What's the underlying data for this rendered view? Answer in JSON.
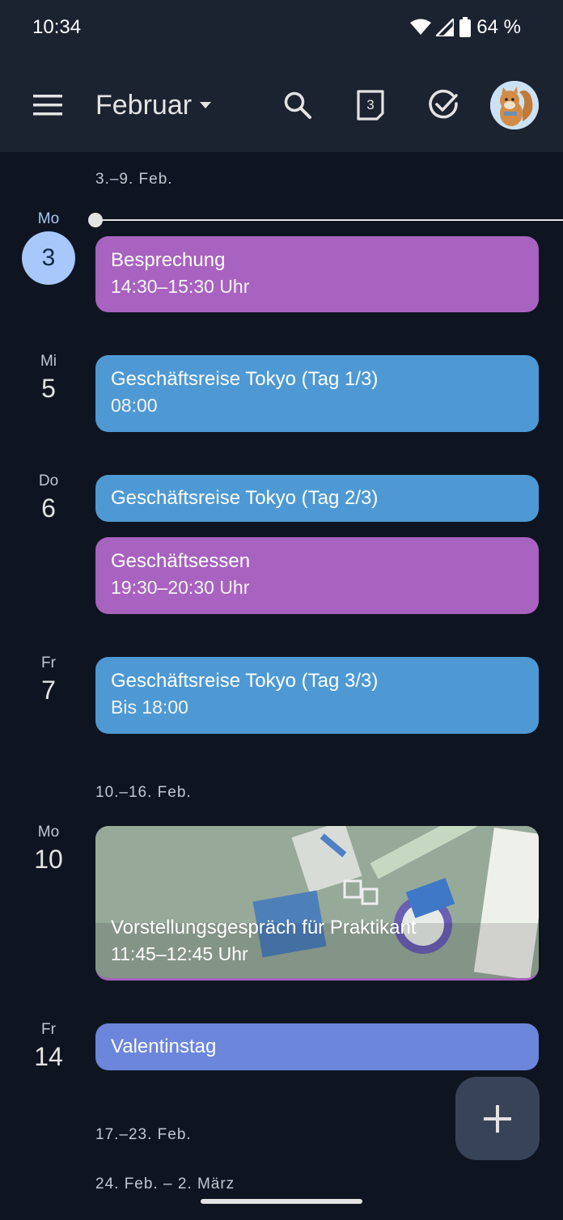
{
  "status_bar": {
    "time": "10:34",
    "battery": "64 %"
  },
  "app_bar": {
    "month": "Februar",
    "today_day": "3"
  },
  "weeks": [
    {
      "label": "3.–9. Feb."
    },
    {
      "label": "10.–16. Feb."
    },
    {
      "label": "17.–23. Feb."
    },
    {
      "label": "24. Feb. – 2. März"
    }
  ],
  "days": [
    {
      "name": "Mo",
      "num": "3"
    },
    {
      "name": "Mi",
      "num": "5"
    },
    {
      "name": "Do",
      "num": "6"
    },
    {
      "name": "Fr",
      "num": "7"
    },
    {
      "name": "Mo",
      "num": "10"
    },
    {
      "name": "Fr",
      "num": "14"
    }
  ],
  "events": [
    {
      "title": "Besprechung",
      "time": "14:30–15:30 Uhr",
      "color": "#a862bf"
    },
    {
      "title": "Geschäftsreise Tokyo (Tag 1/3)",
      "time": "08:00",
      "color": "#4e99d3"
    },
    {
      "title": "Geschäftsreise Tokyo (Tag 2/3)",
      "color": "#4e99d3"
    },
    {
      "title": "Geschäftsessen",
      "time": "19:30–20:30 Uhr",
      "color": "#a862bf"
    },
    {
      "title": "Geschäftsreise Tokyo (Tag 3/3)",
      "time": "Bis 18:00",
      "color": "#4e99d3"
    },
    {
      "title": "Vorstellungsgespräch für Praktikant",
      "time": "11:45–12:45 Uhr",
      "color": "#a862bf"
    },
    {
      "title": "Valentinstag",
      "color": "#6b86db"
    }
  ],
  "icons": {
    "menu": "menu-icon",
    "dropdown": "arrow-drop-down-icon",
    "search": "search-icon",
    "today": "calendar-today-icon",
    "tasks": "task-check-icon",
    "add": "add-icon"
  }
}
